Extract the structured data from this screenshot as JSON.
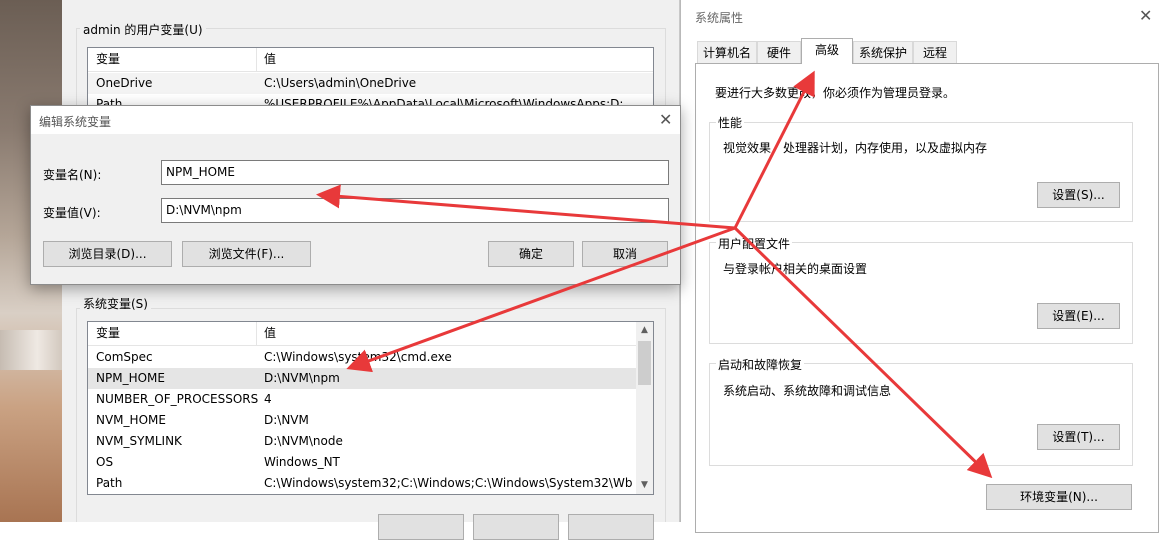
{
  "env_window": {
    "user_group_label": "admin 的用户变量(U)",
    "user_table": {
      "headers": [
        "变量",
        "值"
      ],
      "rows": [
        {
          "name": "OneDrive",
          "value": "C:\\Users\\admin\\OneDrive"
        },
        {
          "name": "Path",
          "value": "%USERPROFILE%\\AppData\\Local\\Microsoft\\WindowsApps;D:..."
        }
      ]
    },
    "system_group_label": "系统变量(S)",
    "system_table": {
      "headers": [
        "变量",
        "值"
      ],
      "rows": [
        {
          "name": "ComSpec",
          "value": "C:\\Windows\\system32\\cmd.exe"
        },
        {
          "name": "NPM_HOME",
          "value": "D:\\NVM\\npm"
        },
        {
          "name": "NUMBER_OF_PROCESSORS",
          "value": "4"
        },
        {
          "name": "NVM_HOME",
          "value": "D:\\NVM"
        },
        {
          "name": "NVM_SYMLINK",
          "value": "D:\\NVM\\node"
        },
        {
          "name": "OS",
          "value": "Windows_NT"
        },
        {
          "name": "Path",
          "value": "C:\\Windows\\system32;C:\\Windows;C:\\Windows\\System32\\Wb..."
        }
      ],
      "selected_row": "NPM_HOME"
    }
  },
  "edit_dialog": {
    "title": "编辑系统变量",
    "name_label": "变量名(N):",
    "name_value": "NPM_HOME",
    "value_label": "变量值(V):",
    "value_value": "D:\\NVM\\npm",
    "browse_dir_label": "浏览目录(D)...",
    "browse_file_label": "浏览文件(F)...",
    "ok_label": "确定",
    "cancel_label": "取消",
    "close_icon": "close-icon"
  },
  "sys_props": {
    "title": "系统属性",
    "tabs": [
      "计算机名",
      "硬件",
      "高级",
      "系统保护",
      "远程"
    ],
    "active_tab": "高级",
    "admin_note": "要进行大多数更改，你必须作为管理员登录。",
    "performance": {
      "label": "性能",
      "desc": "视觉效果，处理器计划，内存使用，以及虚拟内存",
      "button": "设置(S)..."
    },
    "profiles": {
      "label": "用户配置文件",
      "desc": "与登录帐户相关的桌面设置",
      "button": "设置(E)..."
    },
    "startup": {
      "label": "启动和故障恢复",
      "desc": "系统启动、系统故障和调试信息",
      "button": "设置(T)..."
    },
    "env_button": "环境变量(N)...",
    "close_icon": "close-icon"
  },
  "annotation_color": "#e8393a"
}
